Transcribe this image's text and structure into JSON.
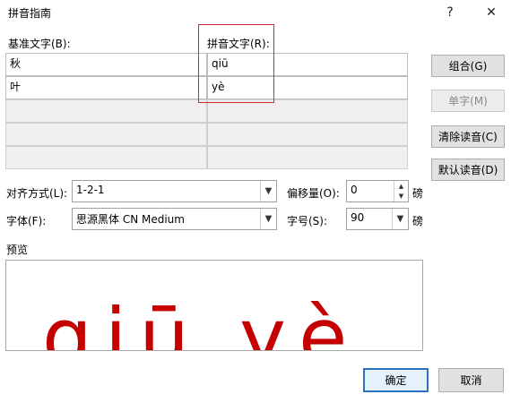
{
  "window": {
    "title": "拼音指南",
    "help": "?",
    "close": "✕"
  },
  "labels": {
    "base_text": "基准文字(B):",
    "pinyin_text": "拼音文字(R):"
  },
  "rows": [
    {
      "base": "秋",
      "pinyin": "qiū"
    },
    {
      "base": "叶",
      "pinyin": "yè"
    },
    {
      "base": "",
      "pinyin": ""
    },
    {
      "base": "",
      "pinyin": ""
    },
    {
      "base": "",
      "pinyin": ""
    }
  ],
  "buttons": {
    "group": "组合(G)",
    "single": "单字(M)",
    "clear": "清除读音(C)",
    "default": "默认读音(D)",
    "ok": "确定",
    "cancel": "取消"
  },
  "options": {
    "align_label": "对齐方式(L):",
    "align_value": "1-2-1",
    "font_label": "字体(F):",
    "font_value": "思源黑体 CN Medium",
    "offset_label": "偏移量(O):",
    "offset_value": "0",
    "offset_unit": "磅",
    "size_label": "字号(S):",
    "size_value": "90",
    "size_unit": "磅"
  },
  "preview": {
    "label": "预览",
    "text": "qiū yè"
  },
  "colors": {
    "highlight": "#d12b2b",
    "preview_text": "#c40000",
    "primary_border": "#2a73c4"
  }
}
